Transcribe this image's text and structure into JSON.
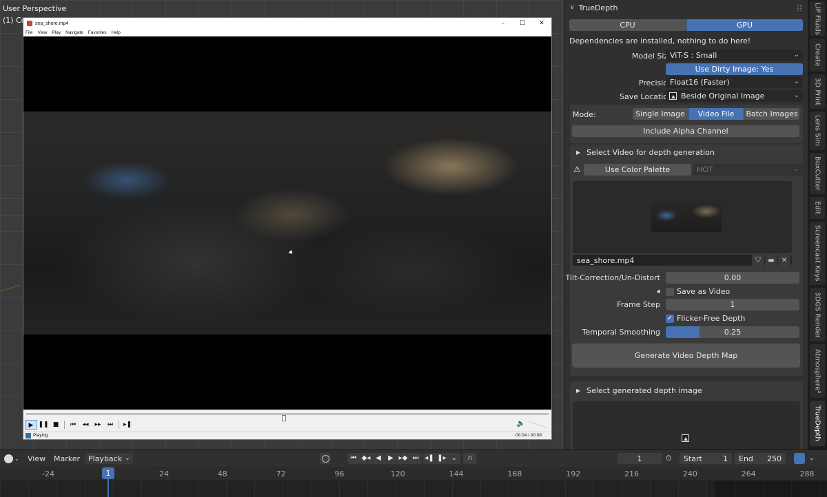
{
  "viewport": {
    "title": "User Perspective",
    "subtitle": "(1) Co"
  },
  "player": {
    "window_title": "sea_shore.mp4",
    "menu": [
      "File",
      "View",
      "Play",
      "Navigate",
      "Favorites",
      "Help"
    ],
    "win_controls": [
      "–",
      "☐",
      "✕"
    ],
    "controls": {
      "play": "▶",
      "pause": "❚❚",
      "stop": "■",
      "prev": "⏮",
      "rewind": "◂◂",
      "forward": "▸▸",
      "next": "⏭",
      "step": "▸❚",
      "volume_icon": "🔈"
    },
    "seek_progress": 0.5,
    "status_text": "Playing",
    "time_text": "00:04 / 00:08"
  },
  "panel": {
    "title": "TrueDepth",
    "device_options": [
      "CPU",
      "GPU"
    ],
    "device_selected": "GPU",
    "deps_message": "Dependencies are installed, nothing to do here!",
    "model_size_label": "Model Size",
    "model_size_value": "ViT-S : Small",
    "dirty_image_button": "Use Dirty Image: Yes",
    "precision_label": "Precision",
    "precision_value": "Float16 (Faster)",
    "save_location_label": "Save Location",
    "save_location_value": "Beside Original Image",
    "mode_label": "Mode:",
    "mode_options": [
      "Single Image",
      "Video File",
      "Batch Images"
    ],
    "mode_selected": "Video File",
    "alpha_button": "Include Alpha Channel",
    "video_section_title": "Select Video for depth generation",
    "warning_icon": "⚠",
    "palette_button": "Use Color Palette",
    "palette_value": "HOT",
    "filename": "sea_shore.mp4",
    "tilt_label": "Tilt-Correction/Un-Distort",
    "tilt_value": "0.00",
    "save_video_label": "Save as Video",
    "save_video_checked": false,
    "frame_step_label": "Frame Step",
    "frame_step_value": "1",
    "flicker_label": "Flicker-Free Depth",
    "flicker_checked": true,
    "smoothing_label": "Temporal Smoothing",
    "smoothing_value": "0.25",
    "smoothing_fraction": 0.25,
    "generate_button": "Generate Video Depth Map",
    "depth_section_title": "Select generated depth image"
  },
  "tabs": [
    "LIP Fluids",
    "Create",
    "3D Print",
    "Lens Sim",
    "BoxCutter",
    "Edit",
    "Screencast Keys",
    "3DGS Render",
    "Atmosphere²",
    "TrueDepth"
  ],
  "active_tab": "TrueDepth",
  "timeline": {
    "menu": [
      "View",
      "Marker",
      "Playback"
    ],
    "current_frame": "1",
    "start_label": "Start",
    "start_value": "1",
    "end_label": "End",
    "end_value": "250",
    "playhead_frame": "1",
    "ruler_ticks": [
      "-24",
      "24",
      "48",
      "72",
      "96",
      "120",
      "144",
      "168",
      "192",
      "216",
      "240",
      "264",
      "288"
    ]
  },
  "colors": {
    "accent": "#4772b3",
    "panel_bg": "#303030",
    "button_bg": "#545454",
    "viewport_bg": "#3b3b3b"
  }
}
